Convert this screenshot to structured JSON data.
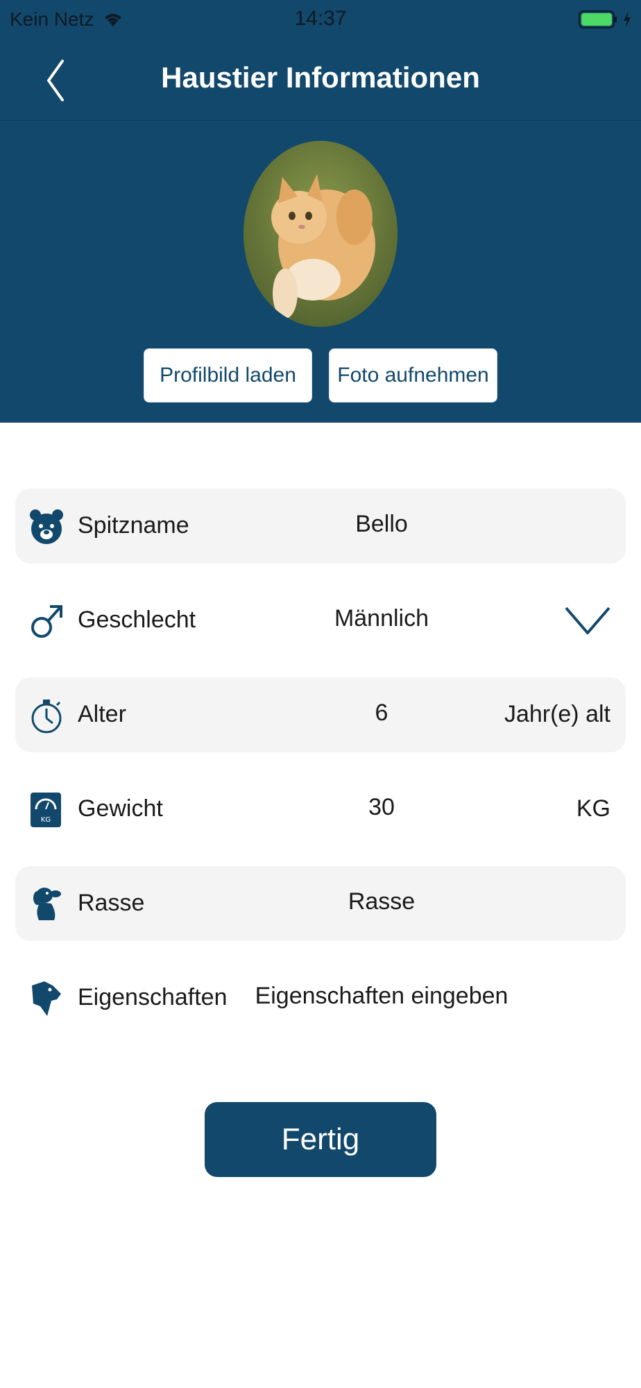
{
  "status_bar": {
    "carrier": "Kein Netz",
    "time": "14:37",
    "battery_color": "#4cd964"
  },
  "nav": {
    "title": "Haustier Informationen",
    "back_icon": "chevron-left-icon"
  },
  "profile": {
    "load_button": "Profilbild laden",
    "photo_button": "Foto aufnehmen"
  },
  "fields": [
    {
      "label": "Spitzname",
      "value": "Bello",
      "icon": "bear-face-icon"
    },
    {
      "label": "Geschlecht",
      "value": "Männlich",
      "icon": "male-symbol-icon"
    },
    {
      "label": "Alter",
      "value": "6",
      "unit": "Jahr(e) alt",
      "icon": "stopwatch-icon"
    },
    {
      "label": "Gewicht",
      "value": "30",
      "unit": "KG",
      "icon": "scale-icon"
    },
    {
      "label": "Rasse",
      "placeholder": "Rasse",
      "icon": "dog-icon"
    },
    {
      "label": "Eigenschaften",
      "placeholder": "Eigenschaften eingeben",
      "icon": "dog-head-icon"
    }
  ],
  "scale_icon_text": "KG",
  "done_button": "Fertig",
  "colors": {
    "primary": "#11486b",
    "row_background": "#f4f4f4"
  }
}
